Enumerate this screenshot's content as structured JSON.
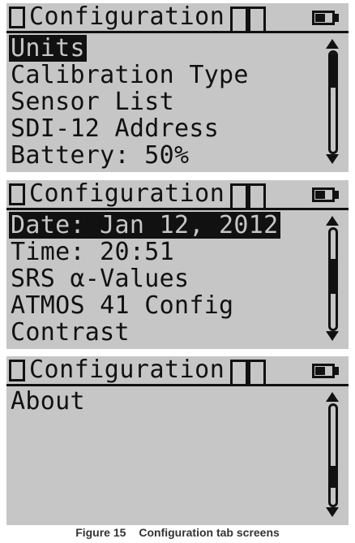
{
  "screens": [
    {
      "title": "Configuration",
      "items": [
        "Units",
        "Calibration Type",
        "Sensor List",
        "SDI-12 Address",
        "Battery: 50%"
      ],
      "selected_index": 0,
      "scroll_position": 0.0,
      "scroll_thumb_fraction": 0.35,
      "battery_level": 0.6
    },
    {
      "title": "Configuration",
      "items": [
        "Date: Jan 12, 2012",
        "Time: 20:51",
        "SRS α-Values",
        "ATMOS 41 Config",
        "Contrast"
      ],
      "selected_index": 0,
      "scroll_position": 0.45,
      "scroll_thumb_fraction": 0.35,
      "battery_level": 0.6
    },
    {
      "title": "Configuration",
      "items": [
        "About"
      ],
      "selected_index": -1,
      "scroll_position": 0.78,
      "scroll_thumb_fraction": 0.22,
      "battery_level": 0.6
    }
  ],
  "caption": {
    "figure": "Figure 15",
    "text": "Configuration tab screens"
  },
  "colors": {
    "lcd_background": "#c6c6c6",
    "lcd_foreground": "#111111"
  },
  "icons": {
    "status_box": "square-outline-icon",
    "tabs": "tab-outline-icon",
    "battery": "battery-icon",
    "scroll_up": "triangle-up-icon",
    "scroll_down": "triangle-down-icon"
  }
}
